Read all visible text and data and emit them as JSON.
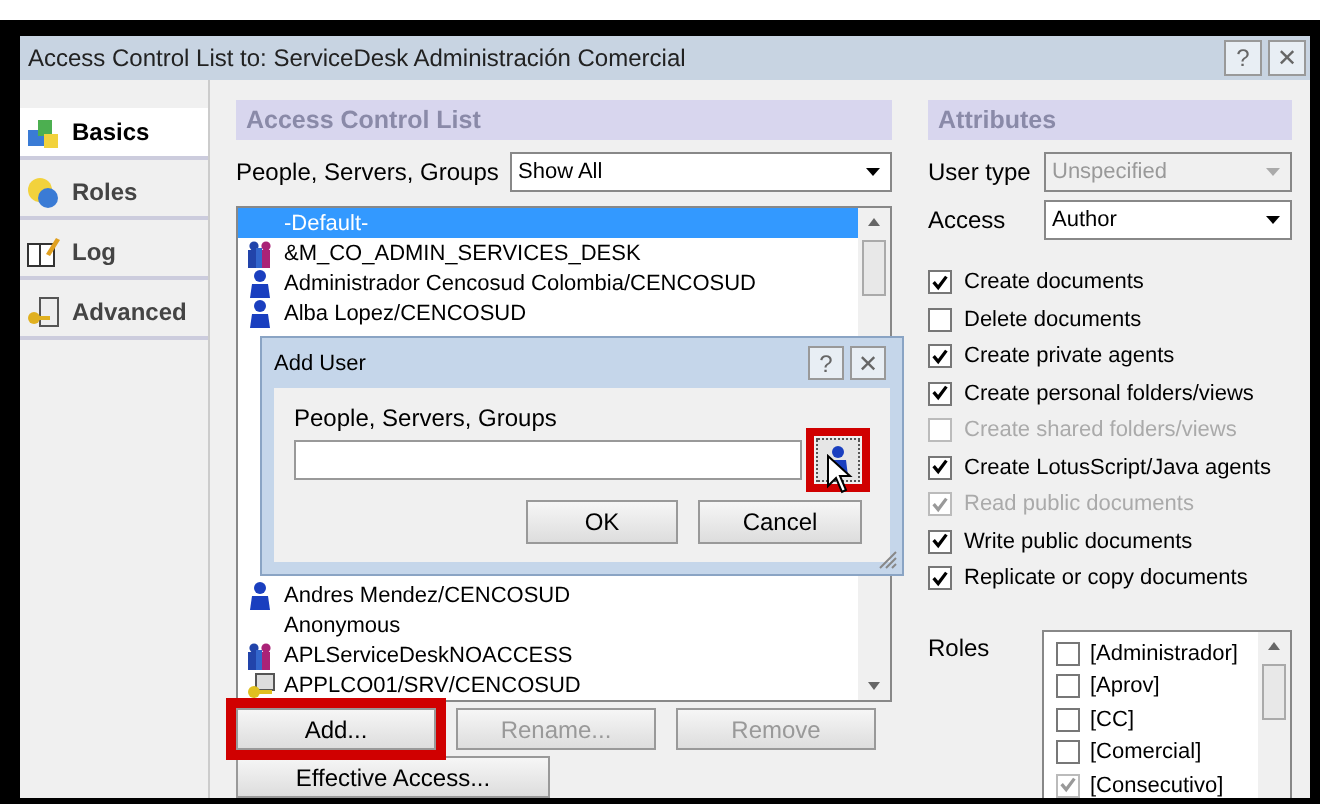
{
  "window": {
    "title": "Access Control List to: ServiceDesk Administración Comercial",
    "buttons": [
      "?",
      "✕"
    ]
  },
  "sidebar": {
    "items": [
      {
        "label": "Basics",
        "selected": true,
        "kind": "basics"
      },
      {
        "label": "Roles",
        "selected": false,
        "kind": "roles"
      },
      {
        "label": "Log",
        "selected": false,
        "kind": "log"
      },
      {
        "label": "Advanced",
        "selected": false,
        "kind": "advanced"
      }
    ]
  },
  "acl": {
    "header": "Access Control List",
    "filter_label": "People, Servers, Groups",
    "filter_value": "Show All",
    "entries": [
      {
        "name": "-Default-",
        "kind": "plain",
        "selected": true
      },
      {
        "name": "&M_CO_ADMIN_SERVICES_DESK",
        "kind": "group",
        "selected": false
      },
      {
        "name": "Administrador Cencosud Colombia/CENCOSUD",
        "kind": "person",
        "selected": false
      },
      {
        "name": "Alba Lopez/CENCOSUD",
        "kind": "person",
        "selected": false
      },
      {
        "name": "Andres Mendez/CENCOSUD",
        "kind": "person",
        "selected": false
      },
      {
        "name": "Anonymous",
        "kind": "plain",
        "selected": false
      },
      {
        "name": "APLServiceDeskNOACCESS",
        "kind": "group",
        "selected": false
      },
      {
        "name": "APPLCO01/SRV/CENCOSUD",
        "kind": "server",
        "selected": false
      }
    ],
    "buttons": [
      {
        "label": "Add...",
        "disabled": false,
        "highlighted": true
      },
      {
        "label": "Rename...",
        "disabled": true,
        "highlighted": false
      },
      {
        "label": "Remove",
        "disabled": true,
        "highlighted": false
      }
    ],
    "effective_access": "Effective Access..."
  },
  "attributes": {
    "header": "Attributes",
    "user_type_label": "User type",
    "user_type": "Unspecified",
    "access_label": "Access",
    "access": "Author",
    "options": [
      {
        "label": "Create documents",
        "checked": true,
        "disabled": false
      },
      {
        "label": "Delete documents",
        "checked": false,
        "disabled": false
      },
      {
        "label": "Create private agents",
        "checked": true,
        "disabled": false
      },
      {
        "label": "Create personal folders/views",
        "checked": true,
        "disabled": false
      },
      {
        "label": "Create shared folders/views",
        "checked": false,
        "disabled": true
      },
      {
        "label": "Create LotusScript/Java agents",
        "checked": true,
        "disabled": false
      },
      {
        "label": "Read public documents",
        "checked": true,
        "disabled": true
      },
      {
        "label": "Write public documents",
        "checked": true,
        "disabled": false
      },
      {
        "label": "Replicate or copy documents",
        "checked": true,
        "disabled": false
      }
    ],
    "roles_label": "Roles",
    "roles": [
      {
        "label": "[Administrador]",
        "checked": false
      },
      {
        "label": "[Aprov]",
        "checked": false
      },
      {
        "label": "[CC]",
        "checked": false
      },
      {
        "label": "[Comercial]",
        "checked": false
      },
      {
        "label": "[Consecutivo]",
        "checked": true
      }
    ]
  },
  "add_user_dialog": {
    "title": "Add User",
    "buttons_top": [
      "?",
      "✕"
    ],
    "field_label": "People, Servers, Groups",
    "ok": "OK",
    "cancel": "Cancel",
    "browse_highlighted": true
  }
}
